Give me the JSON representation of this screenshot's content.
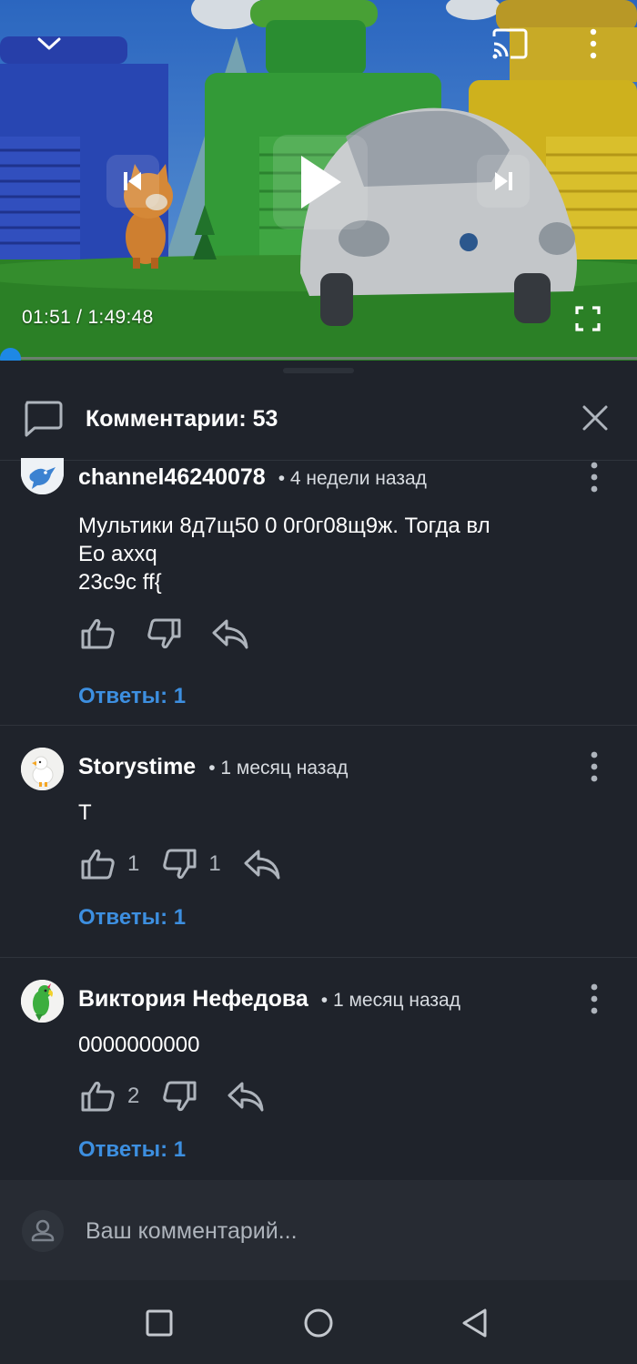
{
  "player": {
    "time_current": "01:51",
    "time_total": "1:49:48",
    "time_display": "01:51 / 1:49:48",
    "progress_fraction": 0.0168,
    "icons": [
      "chevron-down-icon",
      "cast-icon",
      "more-vert-icon",
      "skip-previous-icon",
      "play-icon",
      "skip-next-icon",
      "fullscreen-icon"
    ]
  },
  "comments_panel": {
    "title": "Комментарии: 53",
    "icons": [
      "comment-icon",
      "close-icon"
    ]
  },
  "comments": [
    {
      "author": "channel46240078",
      "time": "• 4 недели назад",
      "text": "Мультики 8д7щ50 0 0г0г08щ9ж. Тогда вл\nЕо ахxq\n23с9с ff{",
      "likes": "",
      "dislikes": "",
      "replies": "Ответы: 1",
      "avatar": "bird-avatar"
    },
    {
      "author": "Storystime",
      "time": "• 1 месяц назад",
      "text": "Т",
      "likes": "1",
      "dislikes": "1",
      "replies": "Ответы: 1",
      "avatar": "duck-avatar"
    },
    {
      "author": "Виктория Нефедова",
      "time": "• 1 месяц назад",
      "text": "0000000000",
      "likes": "2",
      "dislikes": "",
      "replies": "Ответы: 1",
      "avatar": "parrot-avatar"
    }
  ],
  "composer": {
    "placeholder": "Ваш комментарий..."
  },
  "colors": {
    "background": "#1f232b",
    "accent": "#3d8fe0",
    "progress": "#1e88e5",
    "secondary_text": "#aeb4bc"
  },
  "navbar": {
    "icons": [
      "recent-apps-icon",
      "home-icon",
      "back-icon"
    ]
  }
}
